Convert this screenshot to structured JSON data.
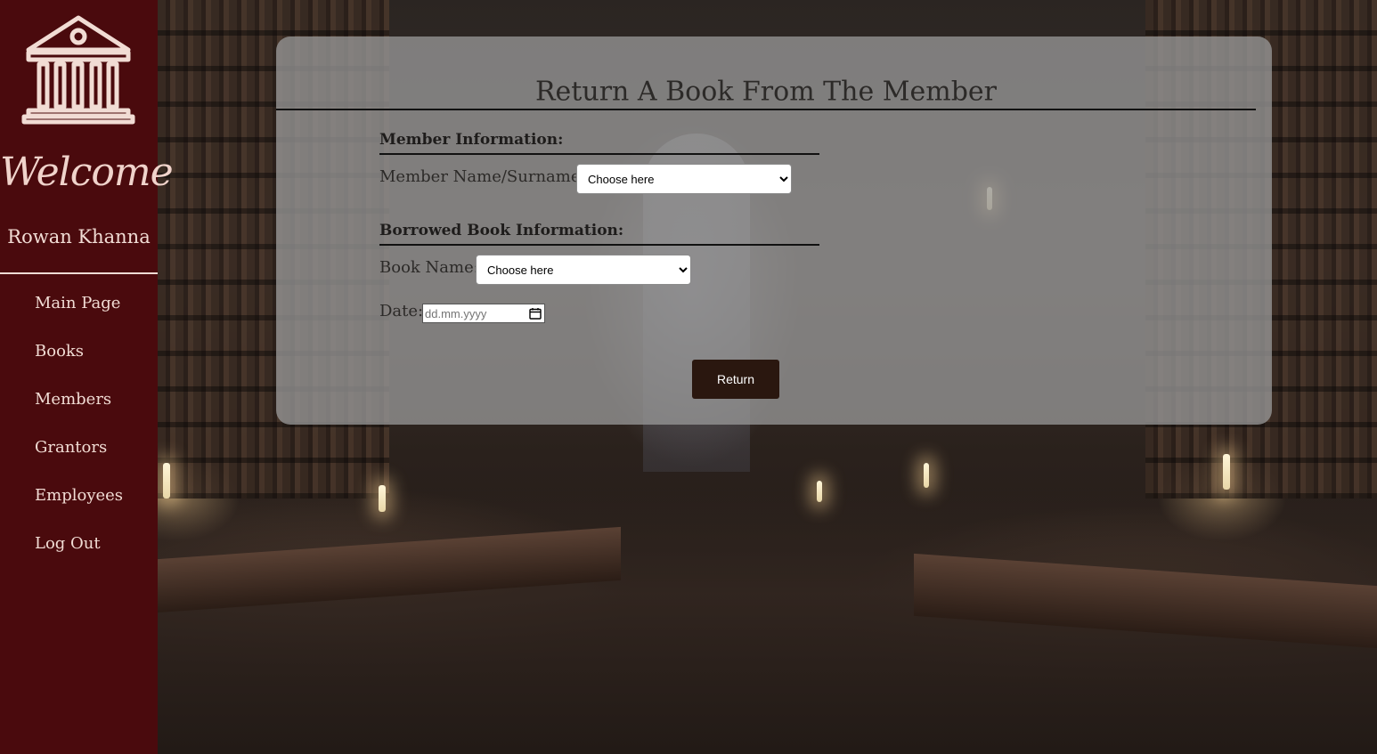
{
  "sidebar": {
    "welcome": "Welcome",
    "user_name": "Rowan Khanna",
    "items": [
      {
        "label": "Main Page"
      },
      {
        "label": "Books"
      },
      {
        "label": "Members"
      },
      {
        "label": "Grantors"
      },
      {
        "label": "Employees"
      },
      {
        "label": "Log Out"
      }
    ]
  },
  "form": {
    "title": "Return A Book From The Member",
    "member_section": "Member Information:",
    "member_label": "Member Name/Surname:",
    "member_selected": "Choose here",
    "book_section": "Borrowed Book Information:",
    "book_label": "Book Name:",
    "book_selected": "Choose here",
    "date_label": "Date:",
    "date_placeholder": "dd.mm.yyyy",
    "submit_label": "Return"
  },
  "colors": {
    "sidebar_bg": "#4a0a0d",
    "sidebar_text": "#f1dcd4",
    "card_bg": "#969696",
    "button_bg": "#2a170f"
  },
  "icons": {
    "logo": "library-building-icon",
    "date_picker": "calendar-icon",
    "select_arrow": "chevron-down-icon"
  }
}
